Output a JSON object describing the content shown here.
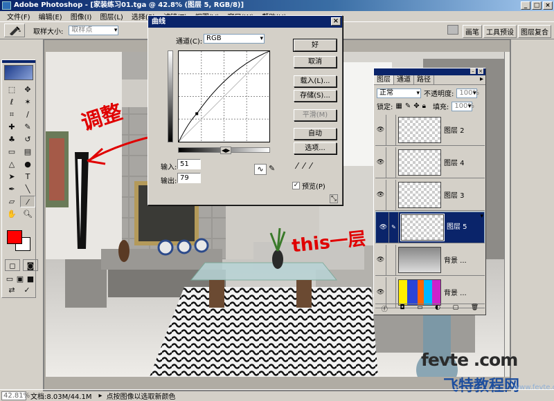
{
  "window": {
    "title": "Adobe Photoshop - [家装练习01.tga @ 42.8% (图层 5, RGB/8)]",
    "controls": [
      "_",
      "□",
      "×"
    ]
  },
  "menu": {
    "items": [
      "文件(F)",
      "编辑(E)",
      "图像(I)",
      "图层(L)",
      "选择(S)",
      "滤镜(T)",
      "视图(V)",
      "窗口(W)",
      "帮助(H)"
    ]
  },
  "options": {
    "sample_size_label": "取样大小:",
    "sample_size_value": "取样点",
    "well_tabs": [
      "画笔",
      "工具预设",
      "图层复合"
    ]
  },
  "curves": {
    "title": "曲线",
    "channel_label": "通道(C):",
    "channel_value": "RGB",
    "buttons": {
      "ok": "好",
      "cancel": "取消",
      "load": "载入(L)...",
      "save": "存储(S)...",
      "smooth": "平滑(M)",
      "auto": "自动",
      "options": "选项..."
    },
    "input_label": "输入:",
    "input_value": "51",
    "output_label": "输出:",
    "output_value": "79",
    "preview_label": "预览(P)",
    "preview_checked": true,
    "curve_point": {
      "input": 51,
      "output": 79
    }
  },
  "layers": {
    "tabs": [
      "图层",
      "通道",
      "路径"
    ],
    "blend_mode": "正常",
    "opacity_label": "不透明度:",
    "opacity_value": "100%",
    "lock_label": "锁定:",
    "fill_label": "填充:",
    "fill_value": "100%",
    "rows": [
      {
        "name": "图层 2",
        "selected": false,
        "thumb": "checker"
      },
      {
        "name": "图层 4",
        "selected": false,
        "thumb": "checker"
      },
      {
        "name": "图层 3",
        "selected": false,
        "thumb": "checker"
      },
      {
        "name": "图层 5",
        "selected": true,
        "thumb": "checker"
      },
      {
        "name": "背景 ...",
        "selected": false,
        "thumb": "photo"
      },
      {
        "name": "背景 ...",
        "selected": false,
        "thumb": "color"
      }
    ]
  },
  "annotations": {
    "adjust": "调整",
    "this_layer": "this一层"
  },
  "status": {
    "zoom": "42.81%",
    "doc": "文档:8.03M/44.1M",
    "hint": "点按图像以选取新颜色"
  },
  "watermark": {
    "line1": "fevte .com",
    "line2": "飞特教程网",
    "line3": "www.fevte.com"
  },
  "colors": {
    "foreground": "#ff0000",
    "background": "#ffffff",
    "selection": "#0a246a",
    "annotation": "#e00000"
  }
}
